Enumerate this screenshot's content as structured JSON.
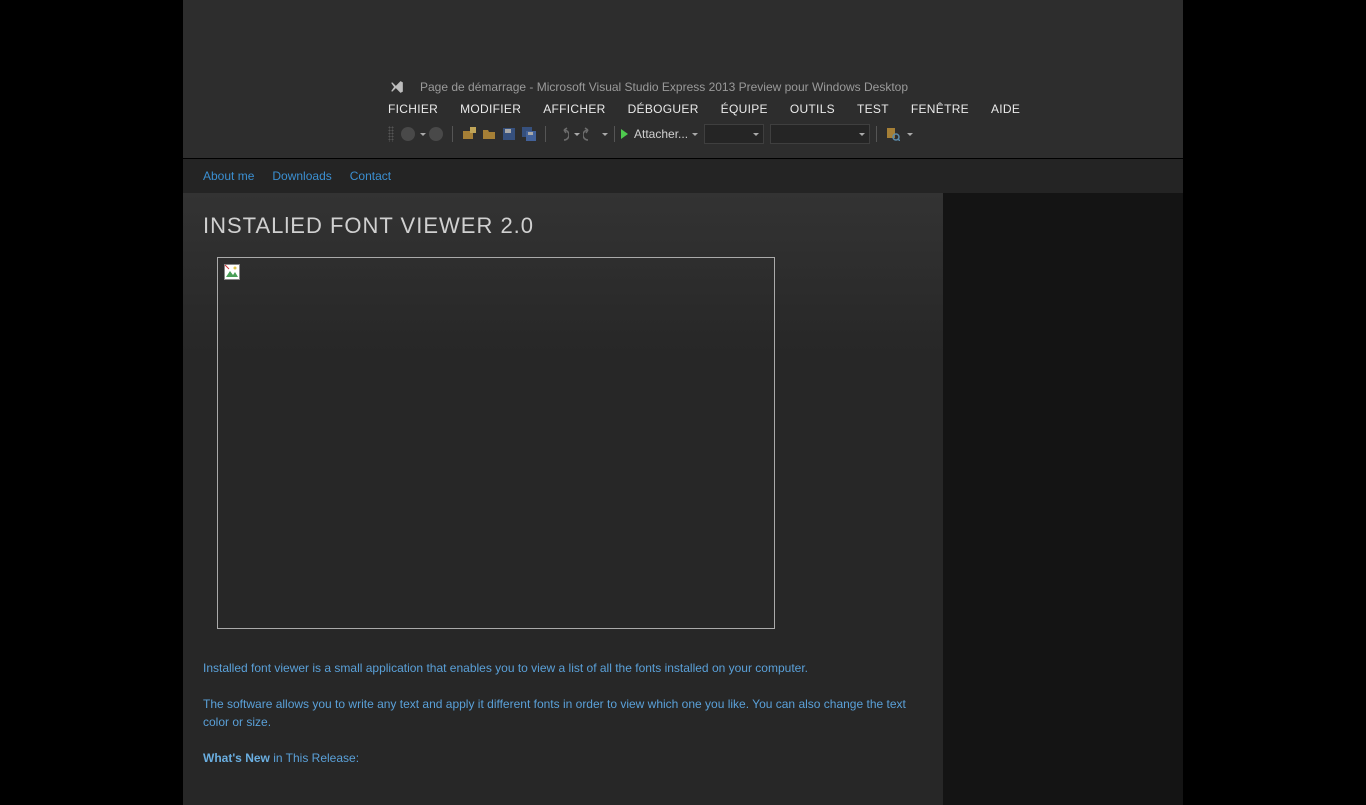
{
  "vs": {
    "title": "Page de démarrage - Microsoft Visual Studio Express 2013 Preview pour Windows Desktop",
    "menu": [
      "FICHIER",
      "MODIFIER",
      "AFFICHER",
      "DÉBOGUER",
      "ÉQUIPE",
      "OUTILS",
      "TEST",
      "FENÊTRE",
      "AIDE"
    ],
    "attach_label": "Attacher..."
  },
  "nav": {
    "about": "About me",
    "downloads": "Downloads",
    "contact": "Contact"
  },
  "article": {
    "title": "INSTALlED FONT VIEWER 2.0",
    "p1": "Installed font viewer is a small application that enables you to view a list of all the fonts installed on your computer.",
    "p2": "The software allows you to write any text and apply it different fonts in order to view which one you like. You can also change the text color or size.",
    "whats_new_label": "What's New",
    "whats_new_tail": " in This Release:"
  }
}
